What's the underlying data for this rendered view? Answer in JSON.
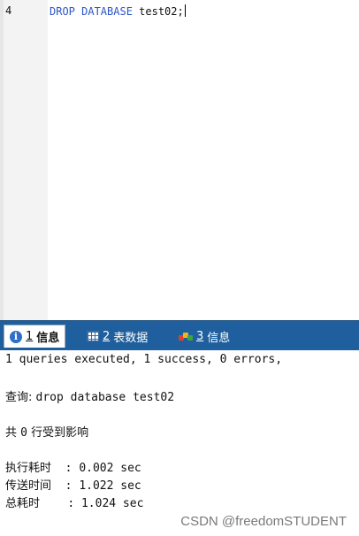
{
  "editor": {
    "line_number": "4",
    "code_keyword": "DROP DATABASE",
    "code_rest": " test02;"
  },
  "tabs": [
    {
      "num": "1",
      "label": "信息",
      "icon": "info-icon"
    },
    {
      "num": "2",
      "label": "表数据",
      "icon": "table-icon"
    },
    {
      "num": "3",
      "label": "信息",
      "icon": "flag-icon"
    }
  ],
  "output": {
    "summary": "1 queries executed, 1 success, 0 errors,",
    "query_label": "查询: ",
    "query_text": "drop database test02",
    "rows_prefix": "共 ",
    "rows_count": "0",
    "rows_suffix": " 行受到影响",
    "exec_label": "执行耗时",
    "exec_value": "  : 0.002 sec",
    "transfer_label": "传送时间",
    "transfer_value": "  : 1.022 sec",
    "total_label": "总耗时",
    "total_value": "    : 1.024 sec"
  },
  "watermark": "CSDN @freedomSTUDENT"
}
